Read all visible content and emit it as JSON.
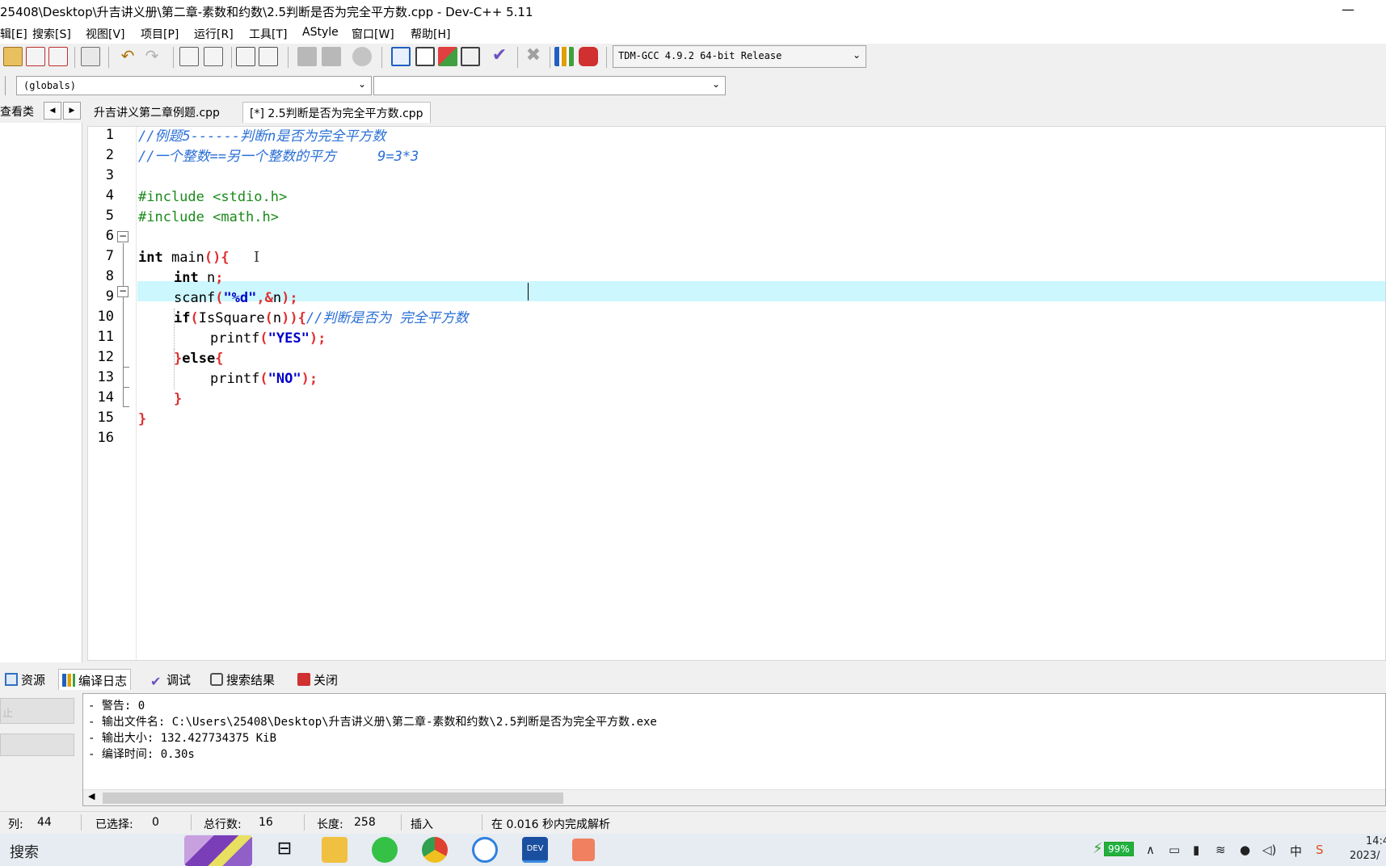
{
  "window": {
    "title": "25408\\Desktop\\升吉讲义册\\第二章-素数和约数\\2.5判断是否为完全平方数.cpp - Dev-C++ 5.11",
    "minimize_label": "—"
  },
  "menu": [
    "编辑[E]",
    "搜索[S]",
    "视图[V]",
    "项目[P]",
    "运行[R]",
    "工具[T]",
    "AStyle",
    "窗口[W]",
    "帮助[H]"
  ],
  "menu_visible": [
    "辑[E]",
    "搜索[S]",
    "视图[V]",
    "项目[P]",
    "运行[R]",
    "工具[T]",
    "AStyle",
    "窗口[W]",
    "帮助[H]"
  ],
  "toolbar": {
    "compiler_value": "TDM-GCC 4.9.2 64-bit Release"
  },
  "classbar": {
    "scope_value": "(globals)",
    "member_value": ""
  },
  "left_panel": {
    "tab_label": "查看类",
    "tab_visible": "查看类",
    "prev": "◀",
    "next": "▶"
  },
  "file_tabs": [
    {
      "label": "升吉讲义第二章例题.cpp",
      "active": false
    },
    {
      "label": "[*] 2.5判断是否为完全平方数.cpp",
      "active": true
    }
  ],
  "editor": {
    "line_numbers": [
      "1",
      "2",
      "3",
      "4",
      "5",
      "6",
      "7",
      "8",
      "9",
      "10",
      "11",
      "12",
      "13",
      "14",
      "15",
      "16"
    ],
    "line1": "//例题5------判断n是否为完全平方数",
    "line2": "//一个整数==另一个整数的平方     9=3*3",
    "line4": "#include <stdio.h>",
    "line5": "#include <math.h>",
    "line7_kw": "int",
    "line7_rest": " main",
    "line7_sym": "(){",
    "line8_kw": "int",
    "line8_rest": " n",
    "line8_sym": ";",
    "line9_a": "scanf",
    "line9_b": "(",
    "line9_c": "\"%d\"",
    "line9_d": ",&",
    "line9_e": "n",
    "line9_f": ");",
    "line10_kw": "if",
    "line10_b": "(",
    "line10_c": "IsSquare",
    "line10_d": "(",
    "line10_e": "n",
    "line10_f": ")){",
    "line10_cmt": "//判断是否为 完全平方数",
    "line11_a": "printf",
    "line11_b": "(",
    "line11_c": "\"YES\"",
    "line11_d": ");",
    "line12_a": "}",
    "line12_kw": "else",
    "line12_b": "{",
    "line13_a": "printf",
    "line13_b": "(",
    "line13_c": "\"NO\"",
    "line13_d": ");",
    "line14": "}",
    "line15": "}",
    "fold_open": "−"
  },
  "bottom_tabs": [
    {
      "label": "资源",
      "icon": "resources-icon"
    },
    {
      "label": "编译日志",
      "icon": "chart-icon",
      "active": true
    },
    {
      "label": "调试",
      "icon": "check-icon"
    },
    {
      "label": "搜索结果",
      "icon": "search-icon"
    },
    {
      "label": "关闭",
      "icon": "close-icon"
    }
  ],
  "bottom_left": {
    "button1": "止"
  },
  "log": [
    "- 警告: 0",
    "- 输出文件名: C:\\Users\\25408\\Desktop\\升吉讲义册\\第二章-素数和约数\\2.5判断是否为完全平方数.exe",
    "- 输出大小: 132.427734375 KiB",
    "- 编译时间: 0.30s"
  ],
  "status": {
    "col_label": "列:",
    "col_value": "44",
    "sel_label": "已选择:",
    "sel_value": "0",
    "lines_label": "总行数:",
    "lines_value": "16",
    "len_label": "长度:",
    "len_value": "258",
    "mode": "插入",
    "parse": "在 0.016 秒内完成解析"
  },
  "taskbar": {
    "search": "搜索",
    "battery": "99%",
    "ime": "中",
    "time": "14:4",
    "date": "2023/"
  }
}
